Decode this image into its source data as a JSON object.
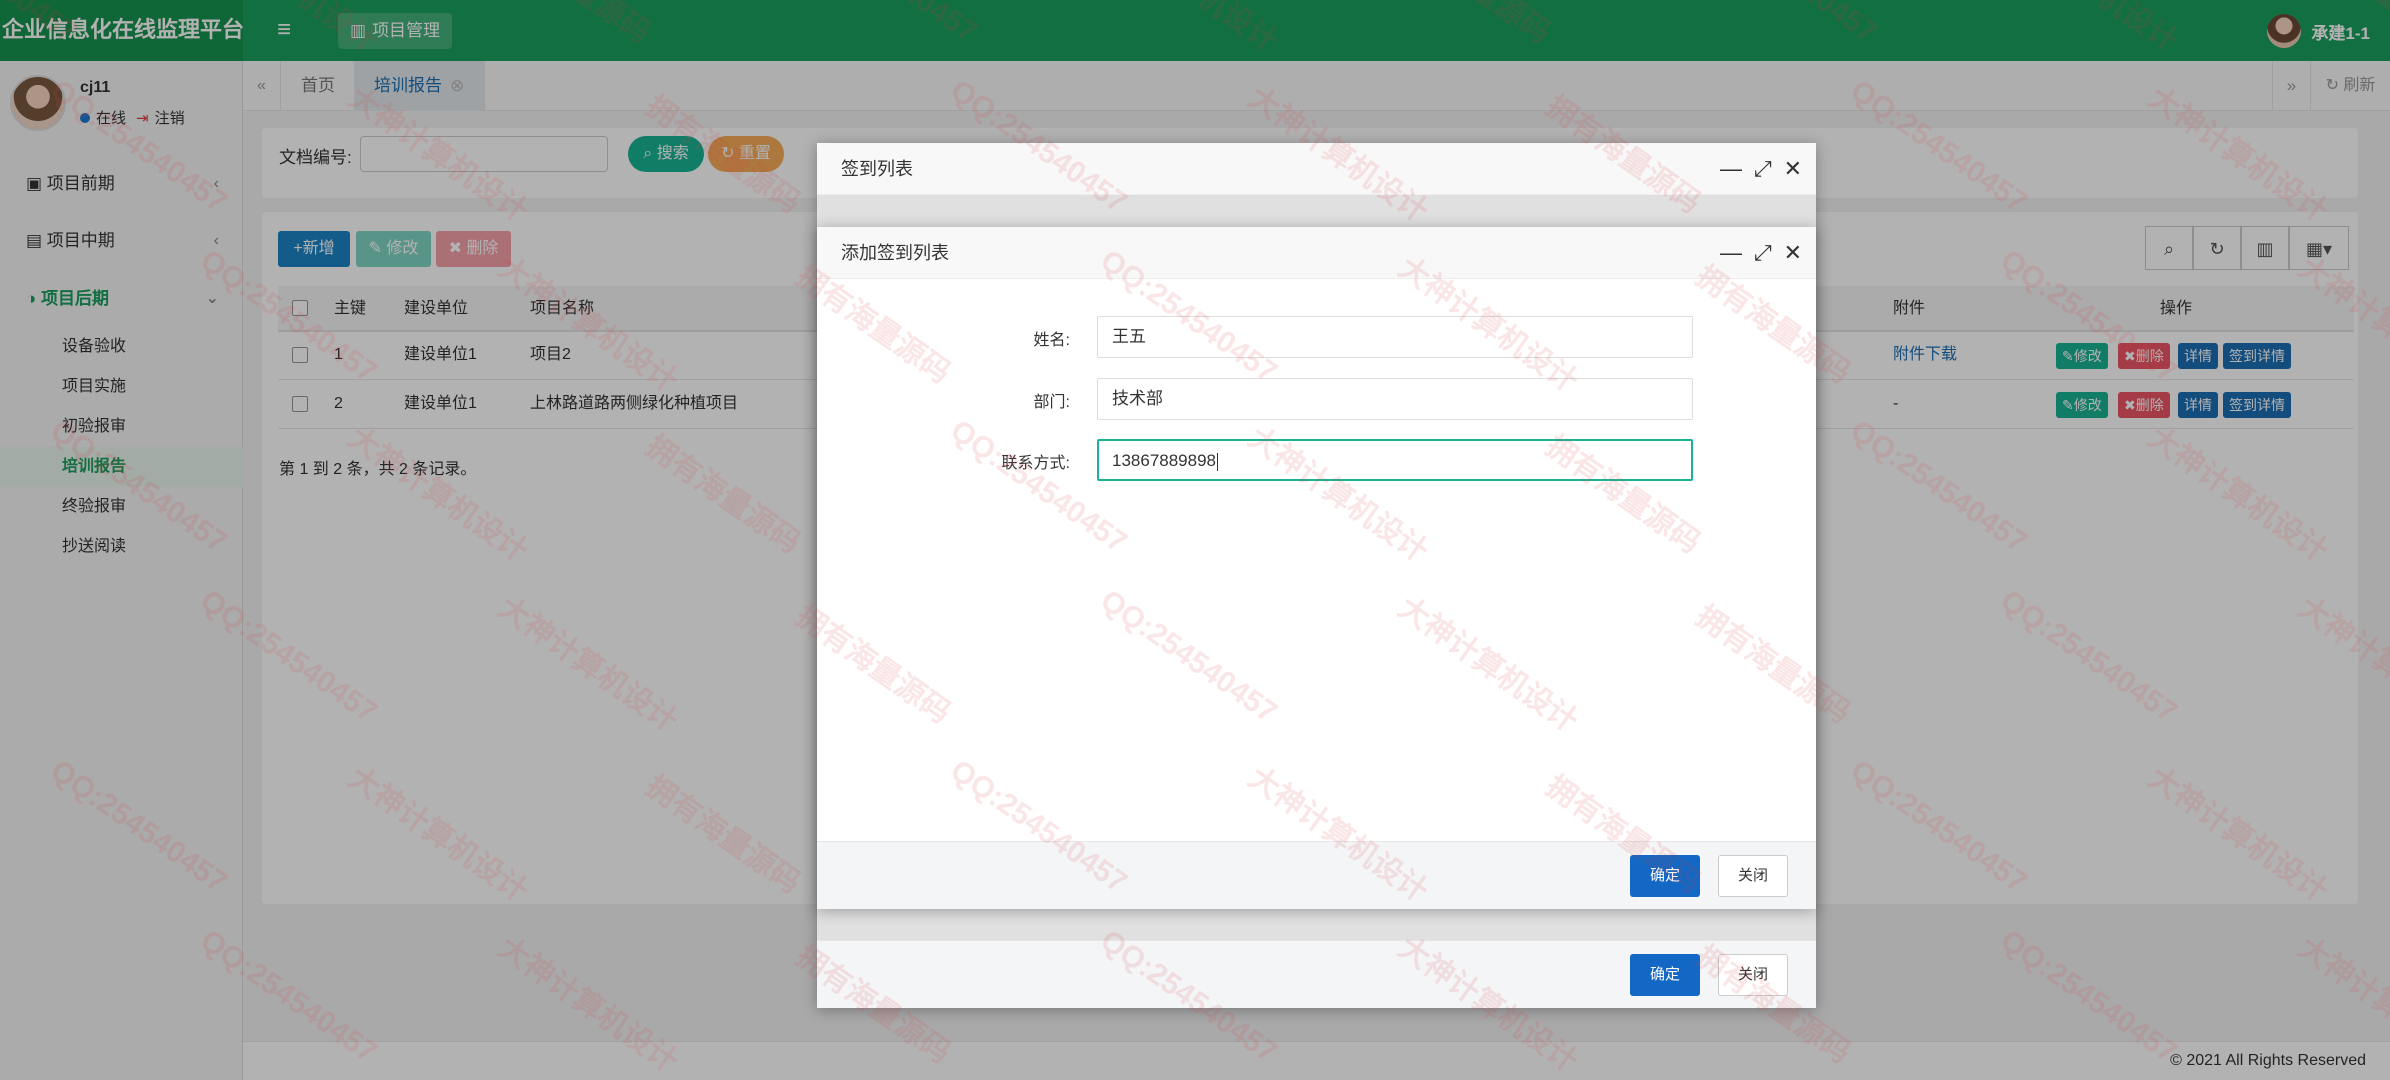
{
  "app": {
    "title": "企业信息化在线监理平台",
    "nav_button": "项目管理",
    "user": "承建1-1"
  },
  "sidebar": {
    "user": {
      "name": "cj11",
      "status": "在线",
      "logout": "注销"
    },
    "groups": [
      {
        "label": "项目前期",
        "icon": "card-icon"
      },
      {
        "label": "项目中期",
        "icon": "phone-icon"
      },
      {
        "label": "项目后期",
        "icon": "half-circle-icon"
      }
    ],
    "subitems": [
      "设备验收",
      "项目实施",
      "初验报审",
      "培训报告",
      "终验报审",
      "抄送阅读"
    ]
  },
  "tabs": {
    "home": "首页",
    "active": "培训报告",
    "refresh": "刷新"
  },
  "search": {
    "doc_no_label": "文档编号:",
    "search_btn": "搜索",
    "reset_btn": "重置"
  },
  "toolbar": {
    "add": "新增",
    "edit": "修改",
    "delete": "删除"
  },
  "table": {
    "headers": {
      "id": "主键",
      "unit": "建设单位",
      "project": "项目名称",
      "attachment": "附件",
      "ops": "操作"
    },
    "rows": [
      {
        "id": "1",
        "unit": "建设单位1",
        "project": "项目2",
        "attachment": "附件下载"
      },
      {
        "id": "2",
        "unit": "建设单位1",
        "project": "上林路道路两侧绿化种植项目",
        "attachment": "-"
      }
    ],
    "ops": {
      "edit": "修改",
      "delete": "删除",
      "detail": "详情",
      "signin_detail": "签到详情"
    },
    "pager": "第 1 到 2 条，共 2 条记录。"
  },
  "dialog_outer": {
    "title": "签到列表",
    "ok": "确定",
    "close": "关闭"
  },
  "dialog_inner": {
    "title": "添加签到列表",
    "fields": [
      {
        "label": "姓名:",
        "value": "王五"
      },
      {
        "label": "部门:",
        "value": "技术部"
      },
      {
        "label": "联系方式:",
        "value": "13867889898"
      }
    ],
    "ok": "确定",
    "close": "关闭"
  },
  "footer": "© 2021 All Rights Reserved",
  "watermark": [
    "QQ:254540457",
    "大神计算机设计",
    "拥有海量源码"
  ],
  "colors": {
    "primary_green": "#1aa05f",
    "blue": "#1268c4",
    "teal": "#1ab394",
    "orange": "#f8ac59",
    "red": "#ed5565"
  }
}
